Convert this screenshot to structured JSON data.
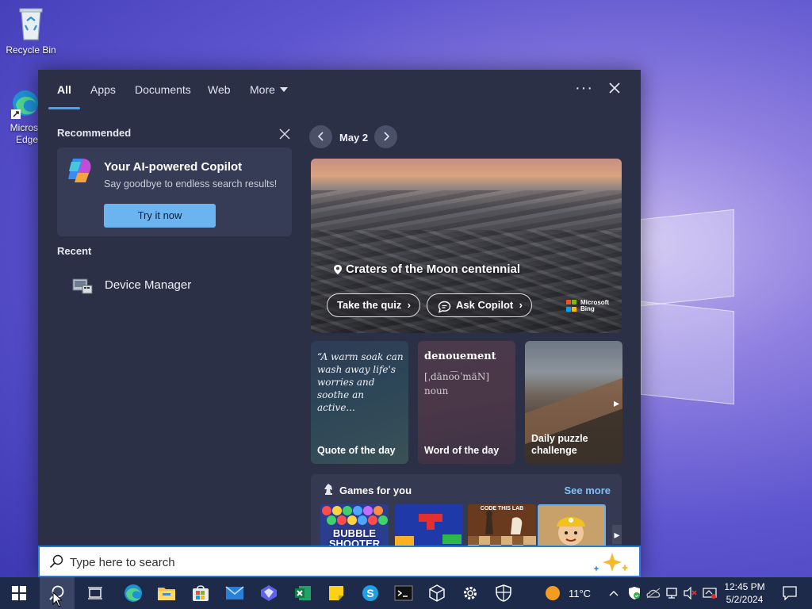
{
  "desktop": {
    "icons": [
      {
        "label": "Recycle Bin"
      },
      {
        "label": "Microsoft Edge",
        "visible_label": "Micros Edge"
      }
    ]
  },
  "search_panel": {
    "tabs": [
      {
        "label": "All",
        "active": true
      },
      {
        "label": "Apps"
      },
      {
        "label": "Documents"
      },
      {
        "label": "Web"
      },
      {
        "label": "More"
      }
    ],
    "more_options_icon": "ellipsis-icon",
    "close_icon": "close-icon",
    "recommended": {
      "heading": "Recommended",
      "card_title": "Your AI-powered Copilot",
      "card_subtitle": "Say goodbye to endless search results!",
      "button_label": "Try it now"
    },
    "recent": {
      "heading": "Recent",
      "items": [
        {
          "label": "Device Manager",
          "icon": "device-manager-icon"
        }
      ]
    },
    "highlights": {
      "date": "May 2",
      "hero_title": "Craters of the Moon centennial",
      "quiz_button": "Take the quiz",
      "copilot_button": "Ask Copilot",
      "brand_line1": "Microsoft",
      "brand_line2": "Bing",
      "cards": [
        {
          "body": "“A warm soak can wash away life's worries and soothe an active...",
          "footer": "Quote of the day"
        },
        {
          "word": "denouement",
          "pronunciation": "[ˌdāno͡oˈmäN]",
          "pos": "noun",
          "footer": "Word of the day"
        },
        {
          "footer": "Daily puzzle challenge"
        }
      ],
      "games_heading": "Games for you",
      "games_see_more": "See more",
      "game_tiles": [
        "BUBBLE SHOOTER",
        "CODE THIS LAB"
      ]
    }
  },
  "searchbox": {
    "placeholder": "Type here to search"
  },
  "taskbar": {
    "weather": "11°C",
    "time": "12:45 PM",
    "date": "5/2/2024"
  },
  "colors": {
    "accent": "#4aa3f0",
    "panel_bg": "#2b3046",
    "taskbar_bg": "#1e2a4a",
    "link": "#7fc0f5"
  }
}
